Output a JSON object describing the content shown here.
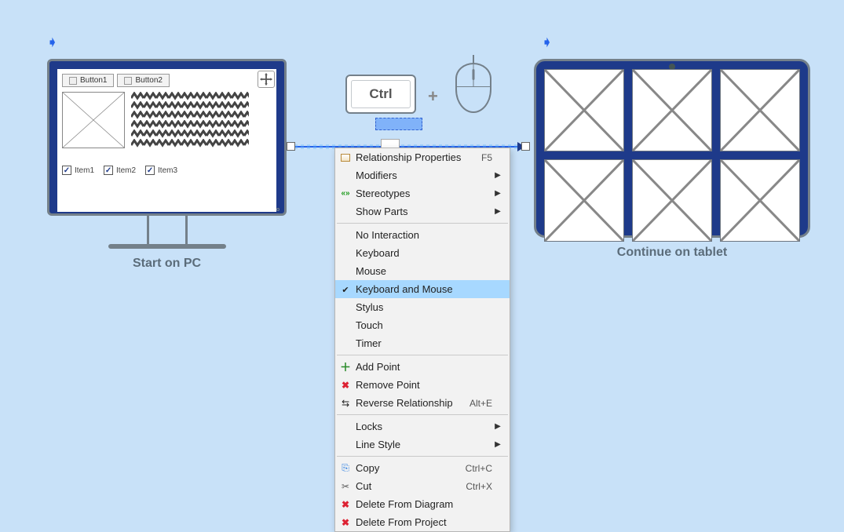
{
  "pc": {
    "caption": "Start on PC",
    "buttons": [
      "Button1",
      "Button2"
    ],
    "checks": [
      "Item1",
      "Item2",
      "Item3"
    ]
  },
  "key_label": "Ctrl",
  "tablet": {
    "caption": "Continue on tablet"
  },
  "menu": {
    "items": [
      {
        "label": "Relationship Properties",
        "shortcut": "F5",
        "icon": "prop"
      },
      {
        "label": "Modifiers",
        "submenu": true
      },
      {
        "label": "Stereotypes",
        "submenu": true,
        "icon": "stereo"
      },
      {
        "label": "Show Parts",
        "submenu": true
      },
      {
        "sep": true
      },
      {
        "label": "No Interaction"
      },
      {
        "label": "Keyboard"
      },
      {
        "label": "Mouse"
      },
      {
        "label": "Keyboard and Mouse",
        "checked": true,
        "selected": true
      },
      {
        "label": "Stylus"
      },
      {
        "label": "Touch"
      },
      {
        "label": "Timer"
      },
      {
        "sep": true
      },
      {
        "label": "Add Point",
        "icon": "plus"
      },
      {
        "label": "Remove Point",
        "icon": "del"
      },
      {
        "label": "Reverse Relationship",
        "shortcut": "Alt+E",
        "icon": "rev"
      },
      {
        "sep": true
      },
      {
        "label": "Locks",
        "submenu": true
      },
      {
        "label": "Line Style",
        "submenu": true
      },
      {
        "sep": true
      },
      {
        "label": "Copy",
        "shortcut": "Ctrl+C",
        "icon": "copy"
      },
      {
        "label": "Cut",
        "shortcut": "Ctrl+X",
        "icon": "cut"
      },
      {
        "label": "Delete From Diagram",
        "icon": "del"
      },
      {
        "label": "Delete From Project",
        "icon": "del"
      }
    ]
  }
}
